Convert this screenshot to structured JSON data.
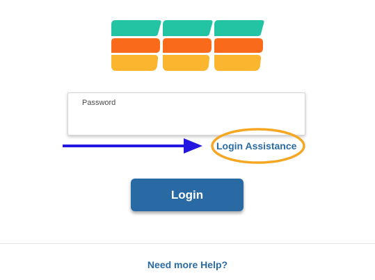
{
  "logo": {
    "name": "ess-logo-icon",
    "colors": {
      "top": "#22c4a4",
      "middle": "#f96a1b",
      "bottom": "#fbb52f"
    }
  },
  "login_form": {
    "password_label": "Password",
    "password_value": "",
    "assistance_link": "Login Assistance",
    "login_button": "Login"
  },
  "footer": {
    "help_link": "Need more Help?"
  },
  "annotations": {
    "arrow_color": "#2418e0",
    "highlight_color": "#f5a623"
  },
  "colors": {
    "link": "#2a6ba3",
    "button": "#2a6aa4"
  }
}
